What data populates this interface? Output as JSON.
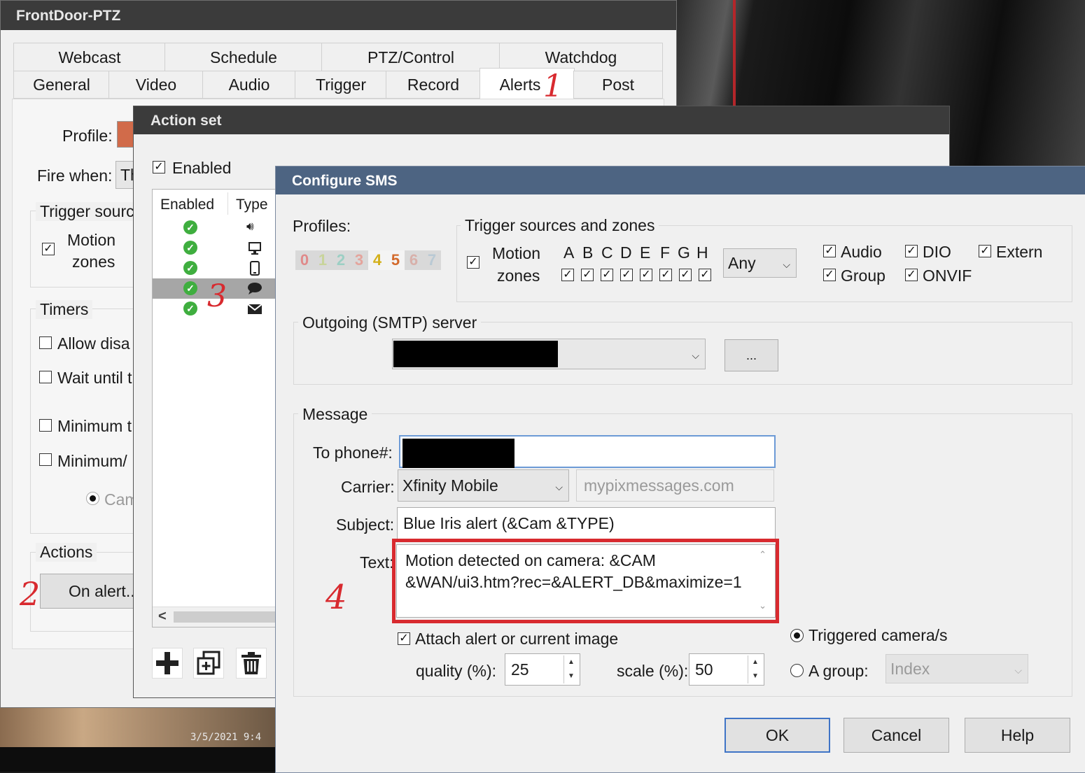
{
  "main_window": {
    "title": "FrontDoor-PTZ",
    "tabs_row1": [
      "Webcast",
      "Schedule",
      "PTZ/Control",
      "Watchdog"
    ],
    "tabs_row2": [
      "General",
      "Video",
      "Audio",
      "Trigger",
      "Record",
      "Alerts",
      "Post"
    ],
    "active_tab": "Alerts",
    "profile_label": "Profile:",
    "fire_when_label": "Fire when:",
    "fire_when_value": "Th",
    "trigger_sources_legend": "Trigger sourc",
    "motion_label": "Motion",
    "zones_label": "zones",
    "timers_legend": "Timers",
    "timers": [
      "Allow disa",
      "Wait until t",
      "Minimum t",
      "Minimum/"
    ],
    "cam_radio": "Cam",
    "actions_legend": "Actions",
    "on_alert_button": "On alert..."
  },
  "action_set": {
    "title": "Action set",
    "enabled_label": "Enabled",
    "col_enabled": "Enabled",
    "col_type": "Type",
    "rows": [
      {
        "type_icon": "speaker-icon"
      },
      {
        "type_icon": "monitor-icon"
      },
      {
        "type_icon": "phone-icon"
      },
      {
        "type_icon": "chat-bubble-icon"
      },
      {
        "type_icon": "envelope-icon"
      }
    ],
    "scroll_left": "<",
    "toolbar_icons": [
      "plus-icon",
      "duplicate-icon",
      "trash-icon"
    ]
  },
  "sms": {
    "title": "Configure SMS",
    "profiles_label": "Profiles:",
    "profiles": [
      "0",
      "1",
      "2",
      "3",
      "4",
      "5",
      "6",
      "7"
    ],
    "trigger_legend": "Trigger sources and zones",
    "motion_label": "Motion",
    "zones_label": "zones",
    "zones": [
      "A",
      "B",
      "C",
      "D",
      "E",
      "F",
      "G",
      "H"
    ],
    "zone_mode": "Any",
    "sources": [
      "Audio",
      "DIO",
      "Extern",
      "Group",
      "ONVIF"
    ],
    "smtp_legend": "Outgoing (SMTP) server",
    "smtp_browse": "...",
    "message_legend": "Message",
    "to_phone_label": "To phone#:",
    "carrier_label": "Carrier:",
    "carrier_value": "Xfinity Mobile",
    "carrier_domain": "mypixmessages.com",
    "subject_label": "Subject:",
    "subject_value": "Blue Iris alert (&Cam &TYPE)",
    "text_label": "Text:",
    "text_line1": "Motion detected on camera: &CAM",
    "text_line2": "&WAN/ui3.htm?rec=&ALERT_DB&maximize=1",
    "attach_label": "Attach alert or current image",
    "quality_label": "quality (%):",
    "quality_value": "25",
    "scale_label": "scale (%):",
    "scale_value": "50",
    "triggered_label": "Triggered camera/s",
    "group_label": "A group:",
    "group_value": "Index",
    "ok": "OK",
    "cancel": "Cancel",
    "help": "Help"
  },
  "annotations": [
    "1",
    "2",
    "3",
    "4"
  ],
  "camera_timestamp": "3/5/2021 9:4",
  "colors": {
    "annotation": "#d82a2f",
    "sms_title": "#4d6482",
    "focus_blue": "#3f74c6"
  }
}
